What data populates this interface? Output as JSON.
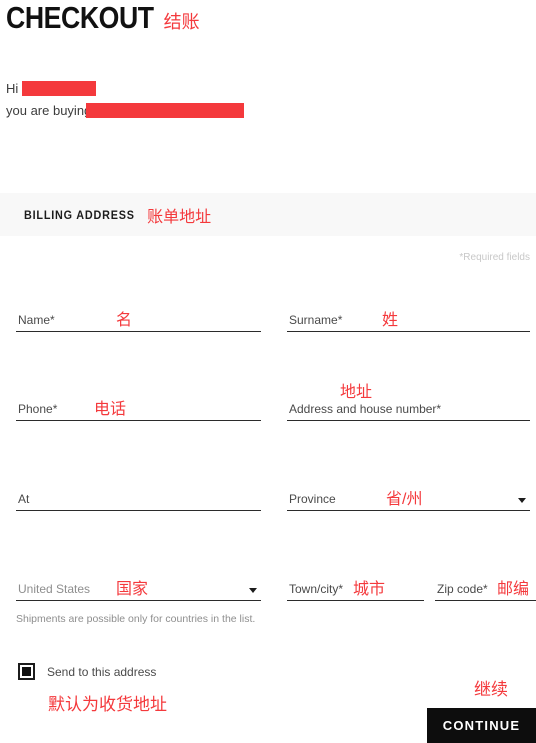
{
  "header": {
    "title": "CHECKOUT",
    "title_annotation": "结账"
  },
  "greeting": {
    "line1_prefix": "Hi ",
    "line2_prefix": "you are buying a"
  },
  "section": {
    "label": "BILLING ADDRESS",
    "annotation": "账单地址",
    "required_note": "*Required fields"
  },
  "fields": {
    "name": {
      "label": "Name*",
      "annotation": "名",
      "value": ""
    },
    "surname": {
      "label": "Surname*",
      "annotation": "姓",
      "value": ""
    },
    "phone": {
      "label": "Phone*",
      "annotation": "电话",
      "value": ""
    },
    "address": {
      "label": "Address and house number*",
      "annotation": "地址",
      "value": ""
    },
    "at": {
      "label": "At",
      "annotation": "",
      "value": ""
    },
    "province": {
      "label": "Province",
      "annotation": "省/州",
      "value": ""
    },
    "country": {
      "label": "United States",
      "annotation": "国家",
      "value": "United States"
    },
    "town": {
      "label": "Town/city*",
      "annotation": "城市",
      "value": ""
    },
    "zip": {
      "label": "Zip code*",
      "annotation": "邮编",
      "value": ""
    }
  },
  "notes": {
    "shipments": "Shipments are possible only for countries in the list."
  },
  "checkbox": {
    "label": "Send to this address",
    "annotation": "默认为收货地址",
    "checked": true
  },
  "actions": {
    "continue_label": "CONTINUE",
    "continue_annotation": "继续"
  },
  "colors": {
    "annotation_red": "#f4393c",
    "band_gray": "#f8f8f8",
    "button_black": "#0d0d0d"
  }
}
